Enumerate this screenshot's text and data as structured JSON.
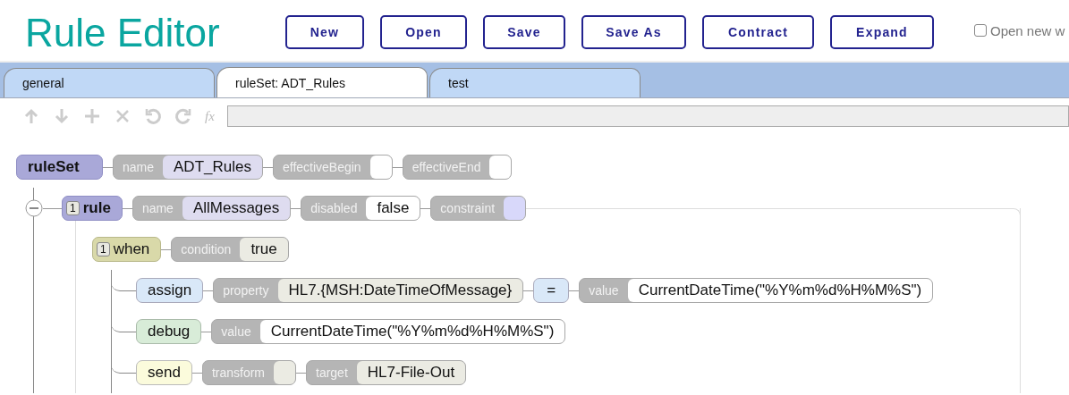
{
  "title": "Rule Editor",
  "buttons": [
    "New",
    "Open",
    "Save",
    "Save As",
    "Contract",
    "Expand"
  ],
  "open_new_window": {
    "label": "Open new w",
    "checked": false
  },
  "tabs": [
    {
      "label": "general",
      "selected": false
    },
    {
      "label": "ruleSet: ADT_Rules",
      "selected": true
    },
    {
      "label": "test",
      "selected": false
    }
  ],
  "toolbar": {
    "function_glyph": "fx"
  },
  "tree": {
    "kind": "ruleSet",
    "label": "ruleSet",
    "props": [
      {
        "kind": "name",
        "name": "name",
        "value": "ADT_Rules"
      },
      {
        "kind": "plain",
        "name": "effectiveBegin"
      },
      {
        "kind": "plain",
        "name": "effectiveEnd"
      }
    ],
    "children": [
      {
        "kind": "rule",
        "label": "rule",
        "badge": "1",
        "expanded": true,
        "props": [
          {
            "kind": "name",
            "name": "name",
            "value": "AllMessages"
          },
          {
            "kind": "plain",
            "name": "disabled",
            "value": "false"
          },
          {
            "kind": "constraint",
            "name": "constraint"
          }
        ],
        "children": [
          {
            "kind": "when",
            "label": "when",
            "badge": "1",
            "props": [
              {
                "kind": "expr",
                "name": "condition",
                "value": "true"
              }
            ],
            "children": [
              {
                "kind": "assign",
                "label": "assign",
                "props": [
                  {
                    "kind": "expr",
                    "name": "property",
                    "value": "HL7.{MSH:DateTimeOfMessage}"
                  },
                  {
                    "kind": "op",
                    "value": "="
                  },
                  {
                    "kind": "plain",
                    "name": "value",
                    "value": "CurrentDateTime(\"%Y%m%d%H%M%S\")"
                  }
                ]
              },
              {
                "kind": "debug",
                "label": "debug",
                "props": [
                  {
                    "kind": "plain",
                    "name": "value",
                    "value": "CurrentDateTime(\"%Y%m%d%H%M%S\")"
                  }
                ]
              },
              {
                "kind": "send",
                "label": "send",
                "props": [
                  {
                    "kind": "expr",
                    "name": "transform"
                  },
                  {
                    "kind": "expr",
                    "name": "target",
                    "value": "HL7-File-Out"
                  }
                ]
              }
            ]
          }
        ]
      }
    ]
  }
}
